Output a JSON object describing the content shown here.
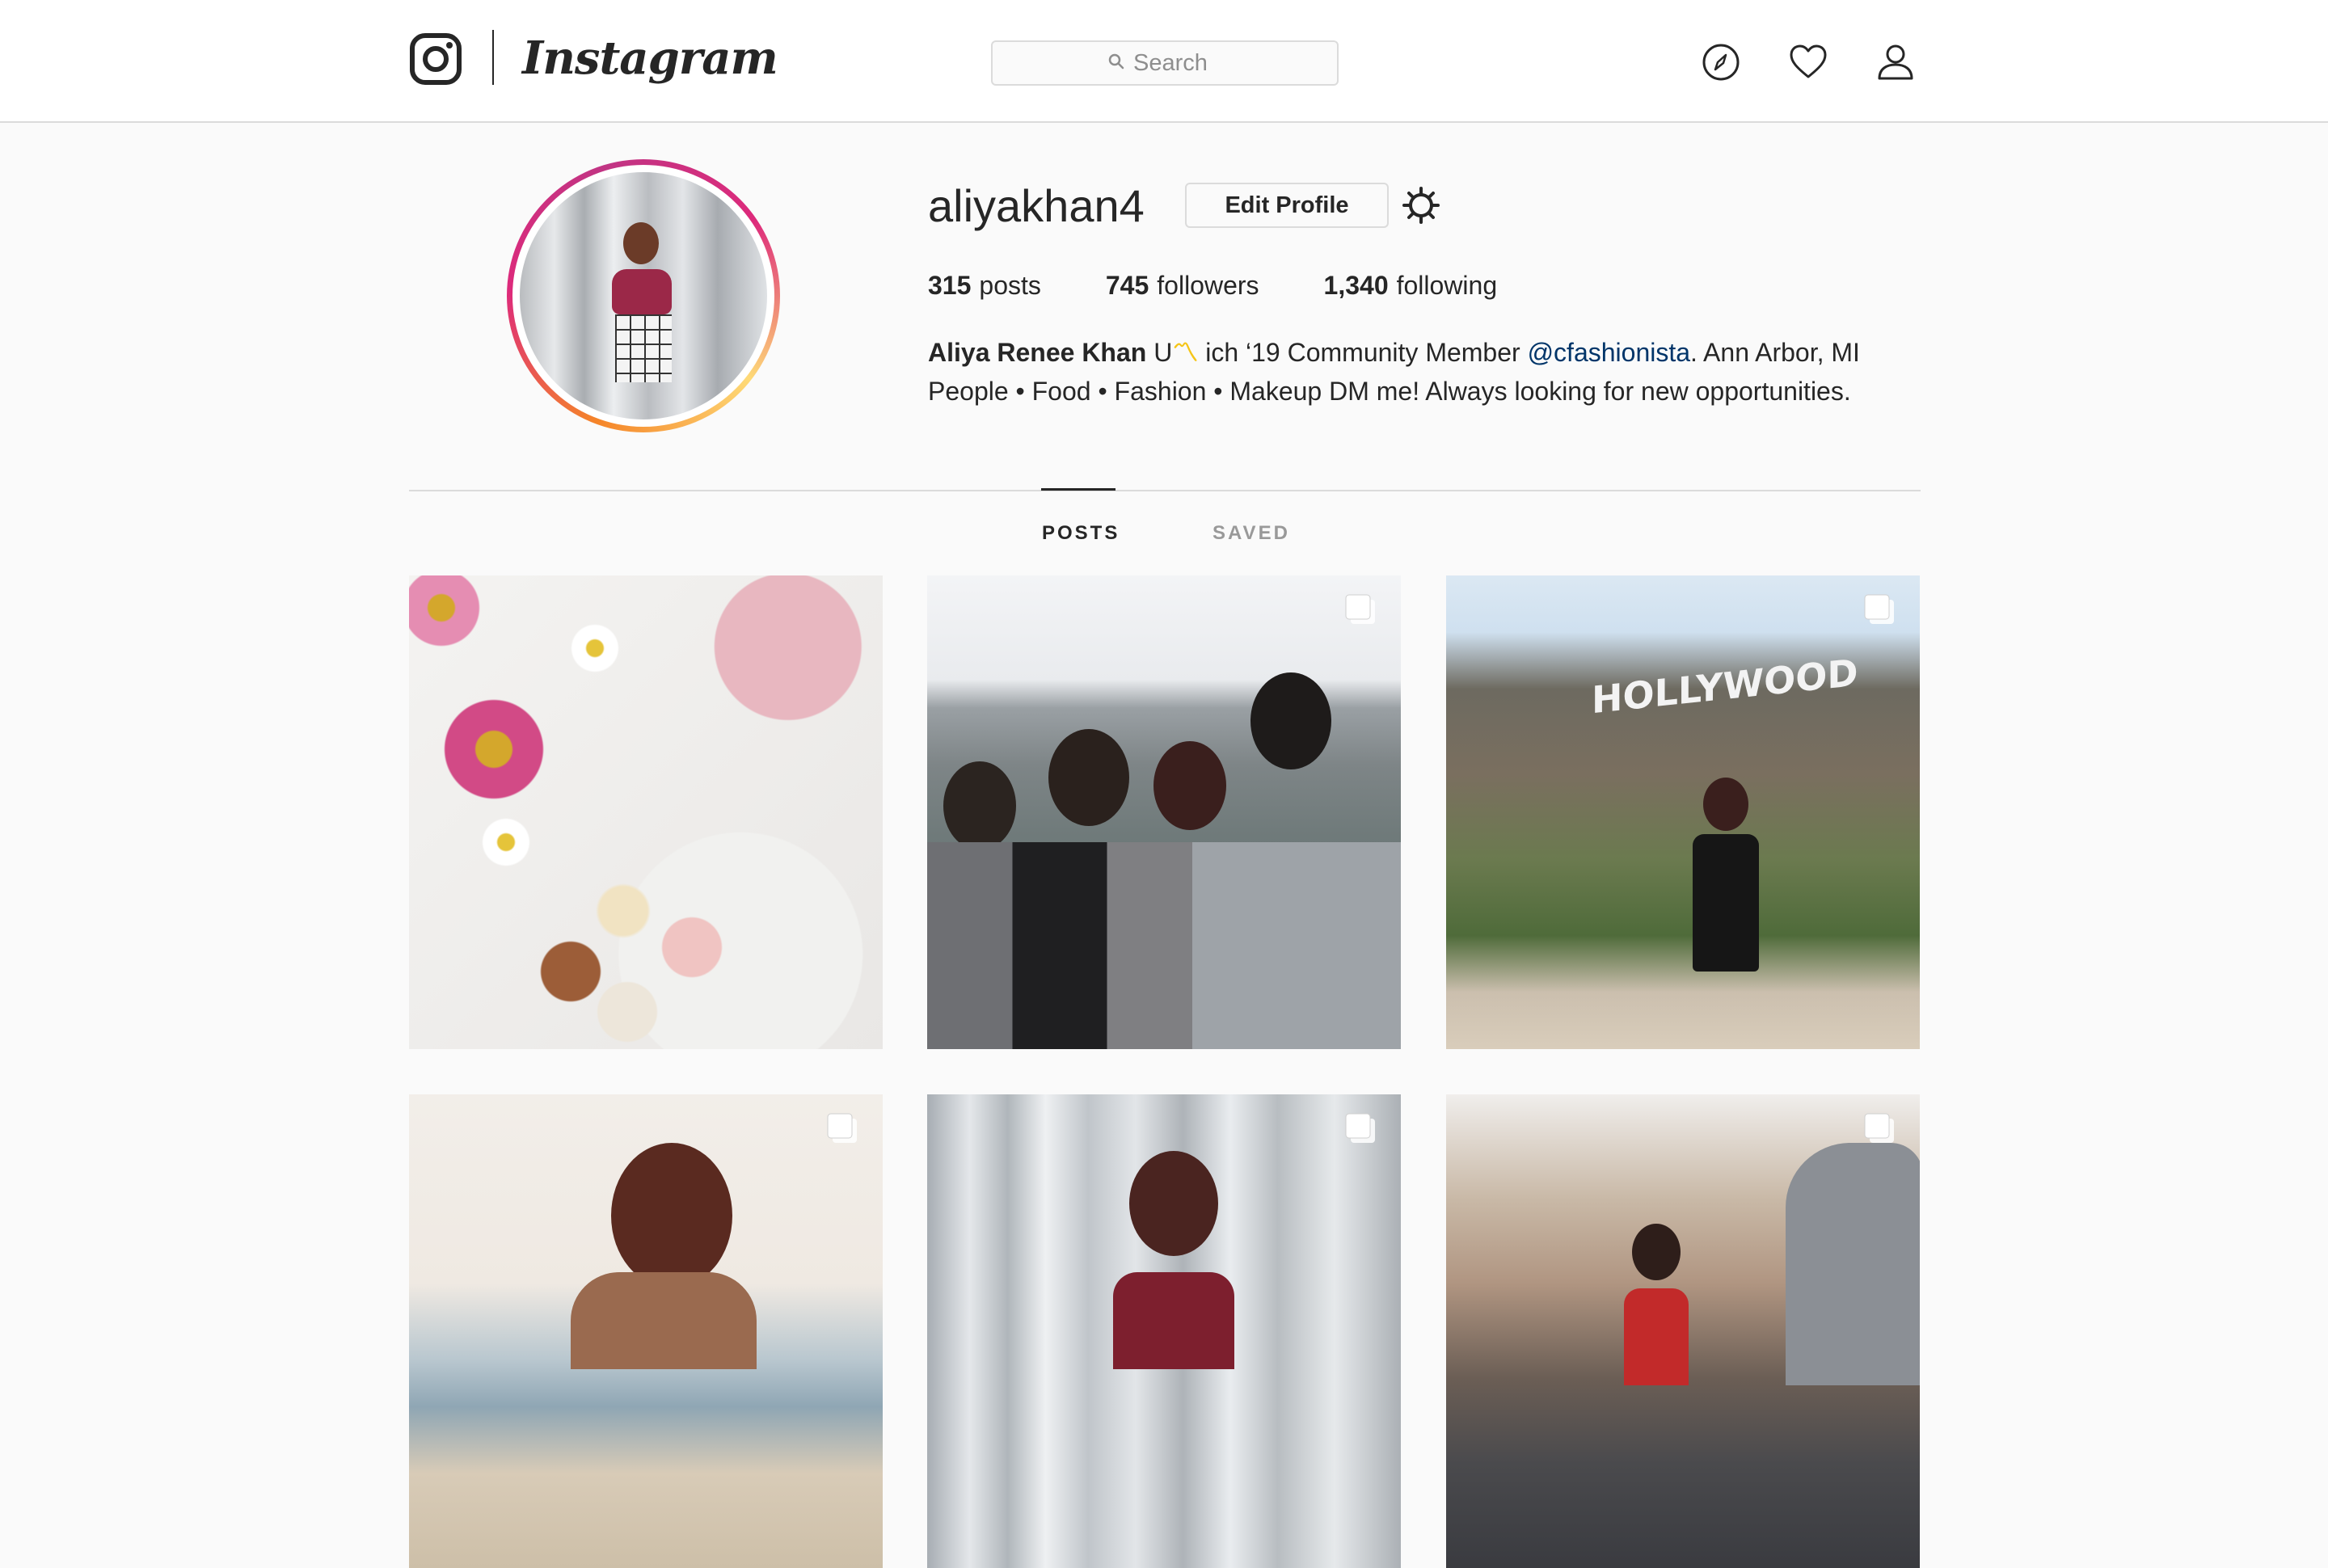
{
  "nav": {
    "wordmark": "Instagram",
    "search_placeholder": "Search",
    "icons": [
      "instagram-glyph-icon",
      "explore-compass-icon",
      "activity-heart-icon",
      "profile-person-icon"
    ]
  },
  "profile": {
    "username": "aliyakhan4",
    "edit_button_label": "Edit Profile",
    "stats": {
      "posts_count": "315",
      "posts_label": "posts",
      "followers_count": "745",
      "followers_label": "followers",
      "following_count": "1,340",
      "following_label": "following"
    },
    "bio": {
      "full_name": "Aliya Renee Khan",
      "line1_text": " U",
      "line1_emoji": "〽",
      "line1_text2": " ich ‘19 Community Member ",
      "mention": "@cfashionista",
      "line1_text3": ". Ann Arbor, MI",
      "line2": "People • Food • Fashion • Makeup DM me! Always looking for new opportunities."
    }
  },
  "tabs": {
    "posts_label": "POSTS",
    "saved_label": "SAVED",
    "active": "POSTS"
  },
  "posts": [
    {
      "subject": "flowers-and-macarons",
      "multi": false
    },
    {
      "subject": "group-of-friends",
      "multi": true
    },
    {
      "subject": "hollywood-sign",
      "multi": true,
      "sign_text": "HOLLYWOOD"
    },
    {
      "subject": "beach-portrait",
      "multi": true
    },
    {
      "subject": "lamp-posts-portrait",
      "multi": true
    },
    {
      "subject": "street-market",
      "multi": true
    }
  ],
  "colors": {
    "mention": "#003569",
    "text": "#262626",
    "muted": "#999999",
    "border": "#dbdbdb",
    "background": "#fafafa"
  }
}
